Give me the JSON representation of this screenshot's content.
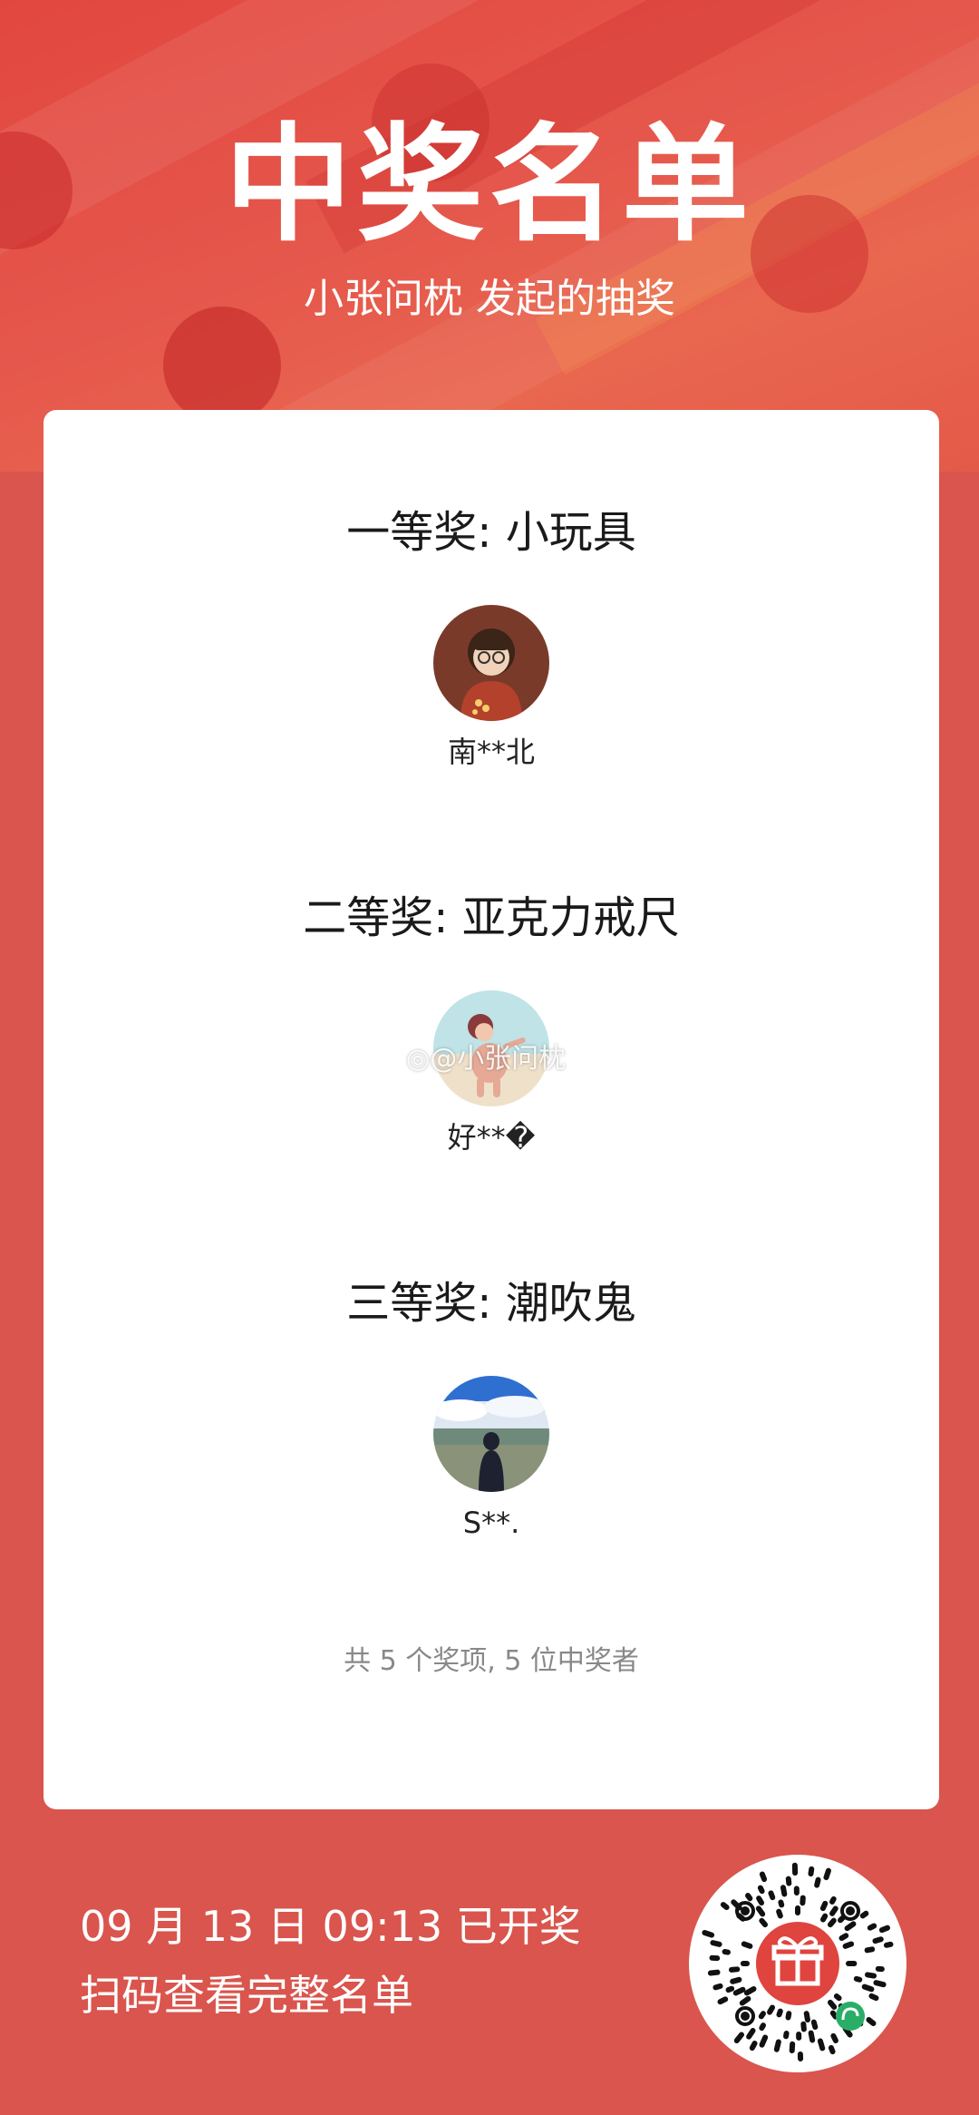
{
  "header": {
    "title": "中奖名单",
    "subtitle": "小张问枕 发起的抽奖"
  },
  "prizes": [
    {
      "title": "一等奖: 小玩具",
      "winner": "南**北",
      "avatar_icon": "cartoon-boy-avatar"
    },
    {
      "title": "二等奖: 亚克力戒尺",
      "winner": "好**�",
      "avatar_icon": "dancing-girl-avatar"
    },
    {
      "title": "三等奖: 潮吹鬼",
      "winner": "S**.",
      "avatar_icon": "landscape-person-avatar"
    }
  ],
  "summary": "共 5 个奖项, 5 位中奖者",
  "watermark": "@小张问枕",
  "footer": {
    "draw_time": "09 月 13 日 09:13 已开奖",
    "scan_hint": "扫码查看完整名单"
  },
  "colors": {
    "background": "#d9554d",
    "header_red": "#e2473f",
    "card": "#ffffff",
    "summary_gray": "#888888",
    "qr_center": "#e0443e",
    "miniprogram_badge": "#2aae67"
  }
}
